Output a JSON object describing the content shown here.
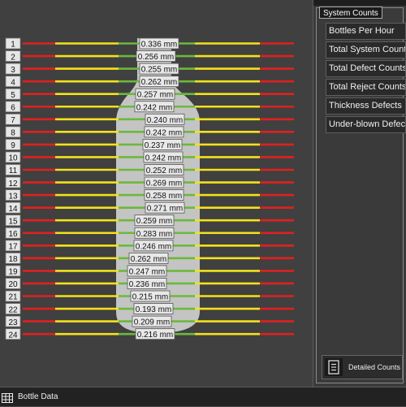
{
  "rows": [
    {
      "number": "1",
      "label": "0.336 mm"
    },
    {
      "number": "2",
      "label": "0.256 mm"
    },
    {
      "number": "3",
      "label": "0.255 mm"
    },
    {
      "number": "4",
      "label": "0.262 mm"
    },
    {
      "number": "5",
      "label": "0.257 mm"
    },
    {
      "number": "6",
      "label": "0.242 mm"
    },
    {
      "number": "7",
      "label": "0.240 mm"
    },
    {
      "number": "8",
      "label": "0.242 mm"
    },
    {
      "number": "9",
      "label": "0.237 mm"
    },
    {
      "number": "10",
      "label": "0.242 mm"
    },
    {
      "number": "11",
      "label": "0.252 mm"
    },
    {
      "number": "12",
      "label": "0.269 mm"
    },
    {
      "number": "13",
      "label": "0.258 mm"
    },
    {
      "number": "14",
      "label": "0.271 mm"
    },
    {
      "number": "15",
      "label": "0.259 mm"
    },
    {
      "number": "16",
      "label": "0.283 mm"
    },
    {
      "number": "17",
      "label": "0.246 mm"
    },
    {
      "number": "18",
      "label": "0.262 mm"
    },
    {
      "number": "19",
      "label": "0.247 mm"
    },
    {
      "number": "20",
      "label": "0.236 mm"
    },
    {
      "number": "21",
      "label": "0.215 mm"
    },
    {
      "number": "22",
      "label": "0.193 mm"
    },
    {
      "number": "23",
      "label": "0.209 mm"
    },
    {
      "number": "24",
      "label": "0.216 mm"
    }
  ],
  "colors": {
    "red": "#e02020",
    "yellow": "#f2e21c",
    "green": "#6cb83c",
    "bottle": "#c4c4c4",
    "label_bg": "#e8e8e8",
    "label_border": "#555555",
    "number_bg": "#e6e6e6"
  },
  "system_counts": {
    "title": "System Counts",
    "items": [
      "Bottles Per Hour",
      "Total System Counts",
      "Total Defect Counts",
      "Total Reject Counts",
      "Thickness Defects",
      "Under-blown Defects"
    ],
    "detailed_button": "Detailed Counts",
    "detailed_icon": "list-icon"
  },
  "bottom_bar": {
    "label": "Bottle Data",
    "icon": "grid-icon"
  }
}
